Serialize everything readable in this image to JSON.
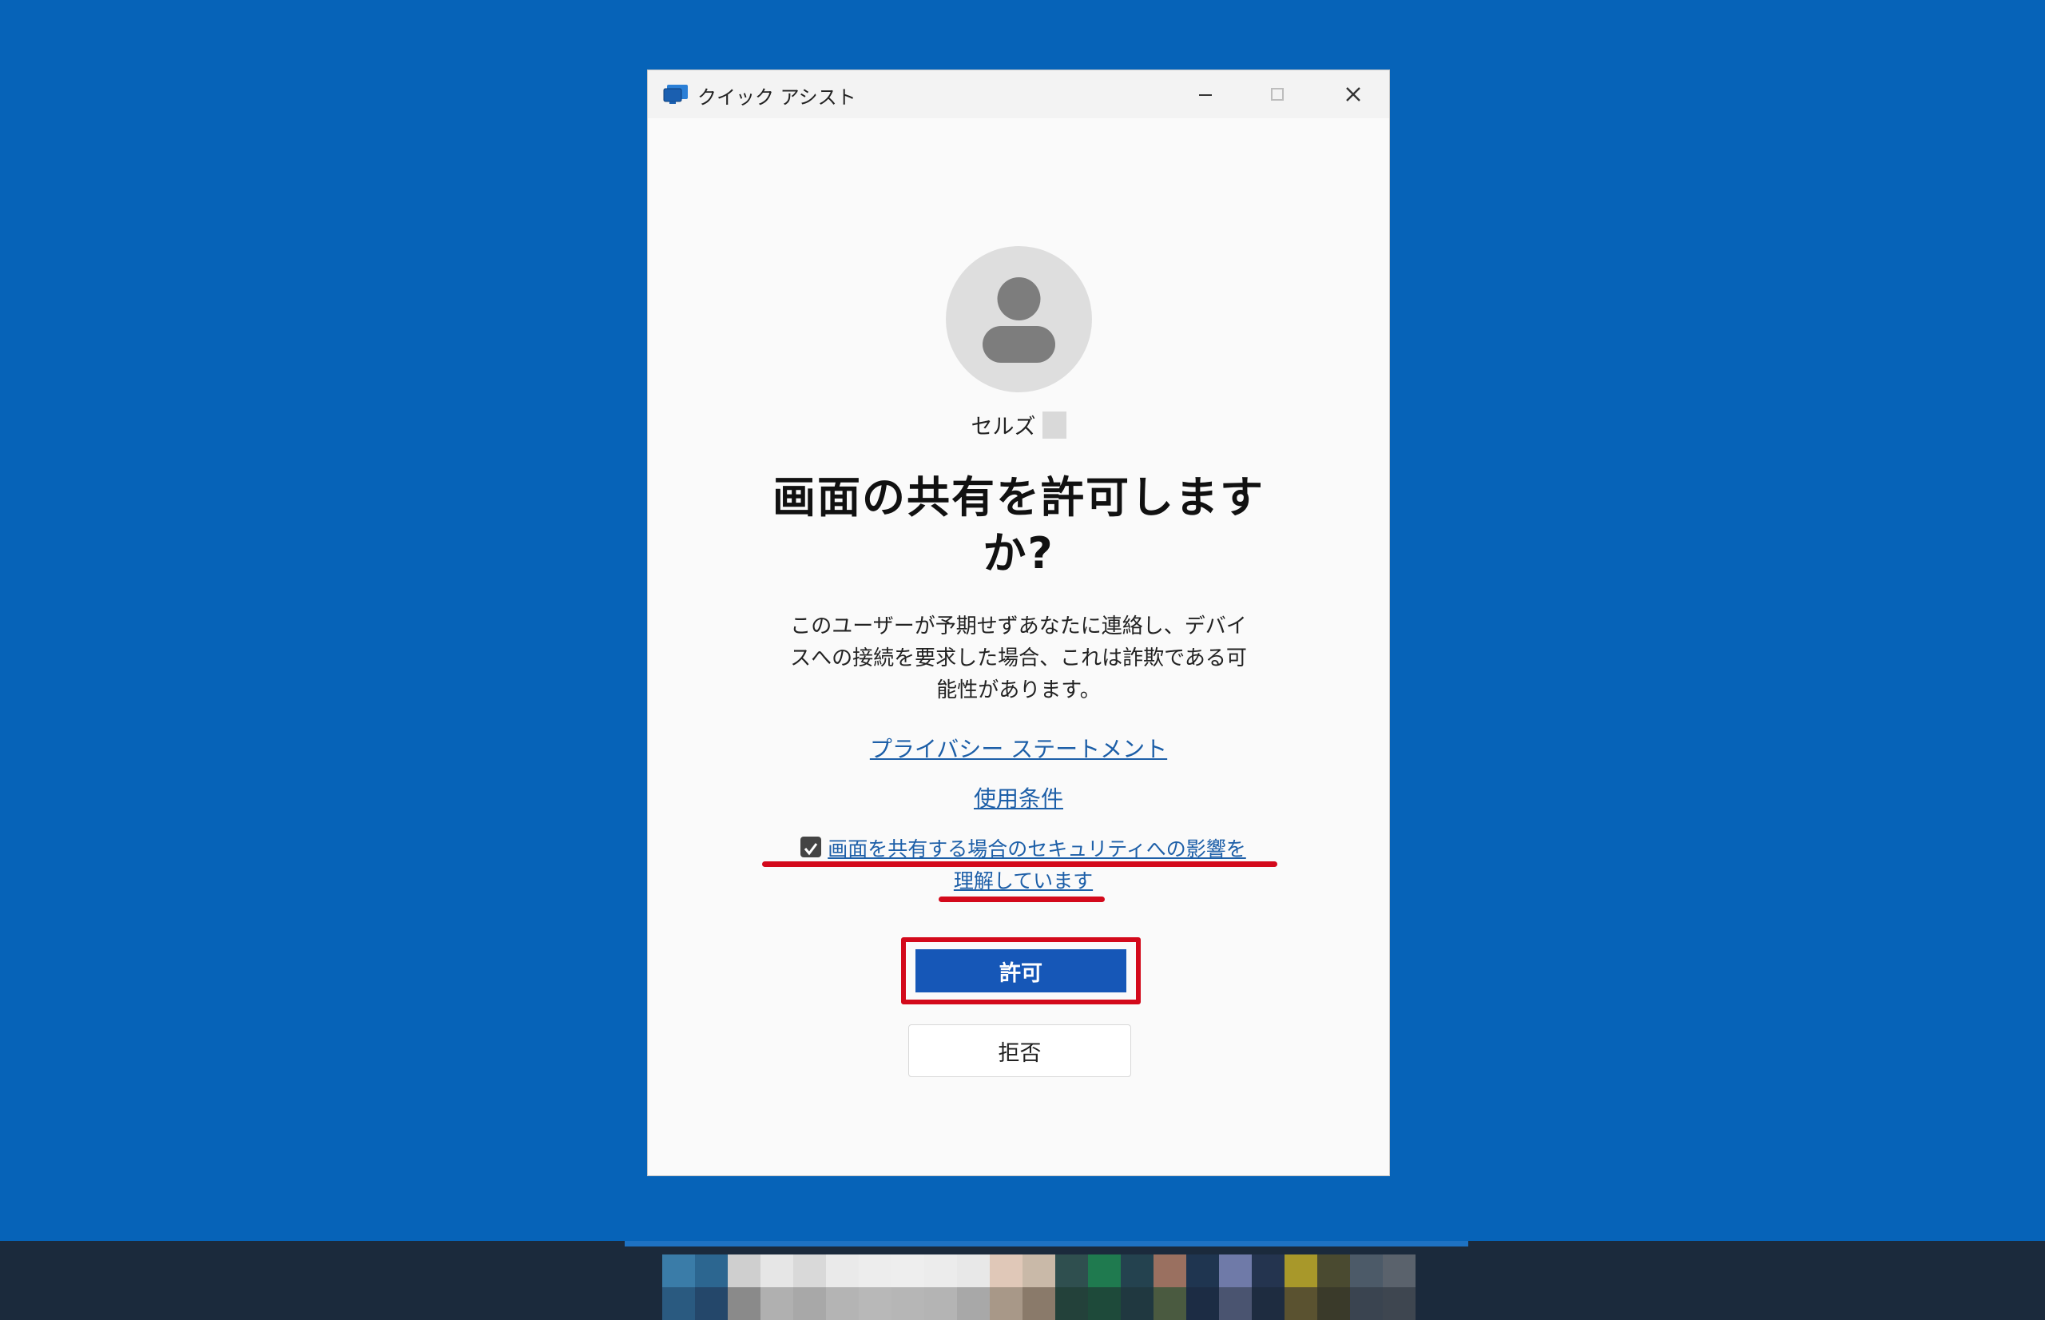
{
  "window": {
    "title": "クイック アシスト",
    "minimize_glyph": "–",
    "close_glyph": "✕"
  },
  "user": {
    "name": "セルズ"
  },
  "dialog": {
    "heading_line1": "画面の共有を許可します",
    "heading_line2": "か?",
    "body_line1": "このユーザーが予期せずあなたに連絡し、デバイ",
    "body_line2": "スへの接続を要求した場合、これは詐欺である可",
    "body_line3": "能性があります。",
    "privacy_link": "プライバシー ステートメント",
    "terms_link": "使用条件",
    "checkbox_label_line1": "画面を共有する場合のセキュリティへの影響を",
    "checkbox_label_line2": "理解しています",
    "checkbox_checked": true,
    "allow_label": "許可",
    "deny_label": "拒否"
  },
  "colors": {
    "desktop": "#0663b8",
    "primary_button": "#1657b7",
    "link": "#1d5fa8",
    "highlight": "#d3091b",
    "taskbar": "#1b2a3c"
  },
  "icons": {
    "app": "quick-assist-icon",
    "avatar": "person-icon",
    "minimize": "minimize-icon",
    "maximize": "maximize-icon",
    "close": "close-icon",
    "check": "checkmark-icon"
  }
}
